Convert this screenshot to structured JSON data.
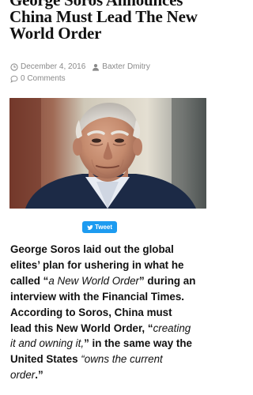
{
  "article": {
    "title_line1": "George Soros Announces",
    "title_line2": "China Must Lead The New",
    "title_line3": "World Order",
    "date": "December 4, 2016",
    "author": "Baxter Dmitry",
    "comments": "0 Comments",
    "tweet_label": "Tweet",
    "body": {
      "l1": "George Soros laid out the global",
      "l2": "elites’ plan for ushering in what he",
      "l3a": "called “",
      "l3b": "a New World Order",
      "l3c": "” during an",
      "l4": "interview with the Financial Times.",
      "l5": "According to Soros, China must",
      "l6a": "lead this New World Order, “",
      "l6b": "creating",
      "l7a": "it and owning it,",
      "l7b": "” in the same way the",
      "l8a": "United States ",
      "l8b": "“owns the current",
      "l9a": "order",
      "l9b": ".”"
    }
  },
  "icons": {
    "date": "clock-icon",
    "author": "user-icon",
    "comments": "comment-icon",
    "tweet": "twitter-bird-icon"
  },
  "colors": {
    "tweet_button": "#1d9bf0",
    "meta_text": "#8a8a8a",
    "title_text": "#111111"
  }
}
